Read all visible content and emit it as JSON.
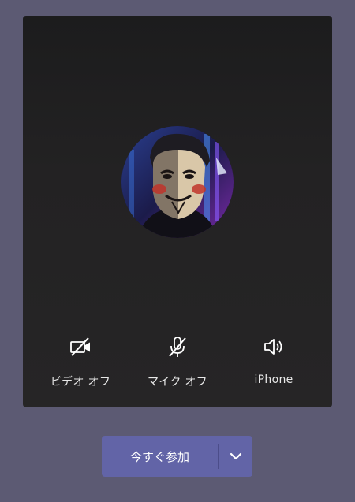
{
  "preview": {
    "avatar_alt": "participant-avatar"
  },
  "controls": {
    "video": {
      "label": "ビデオ オフ",
      "icon": "video-off-icon",
      "state": "off"
    },
    "mic": {
      "label": "マイク オフ",
      "icon": "mic-off-icon",
      "state": "off"
    },
    "audio": {
      "label": "iPhone",
      "icon": "speaker-icon"
    }
  },
  "join": {
    "label": "今すぐ参加",
    "options_icon": "chevron-down-icon"
  },
  "colors": {
    "background": "#5c5a73",
    "card": "#232223",
    "accent": "#6264a7",
    "text": "#e8e8e8"
  }
}
